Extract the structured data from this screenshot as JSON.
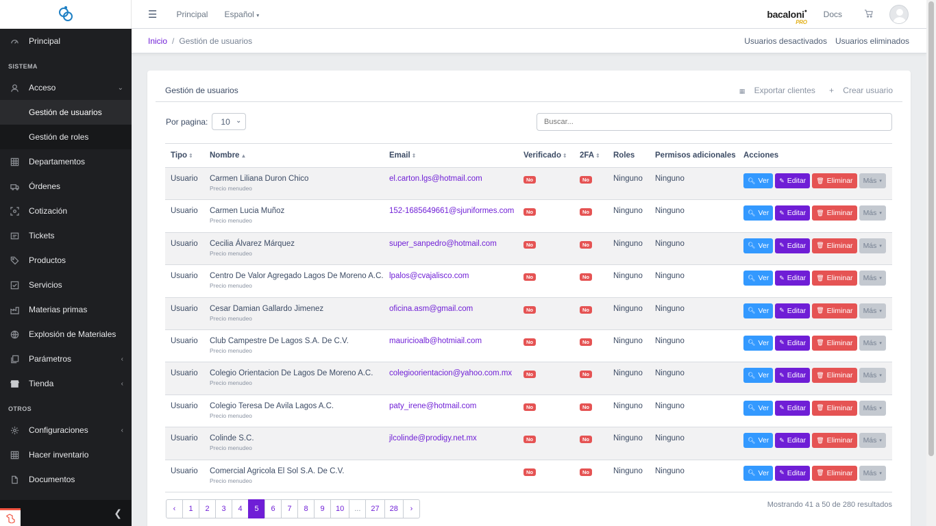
{
  "header": {
    "nav": [
      "Principal",
      "Español"
    ],
    "brand": "bacaloni",
    "brand_suffix": "PRO",
    "docs": "Docs"
  },
  "breadcrumb": {
    "home": "Inicio",
    "current": "Gestión de usuarios"
  },
  "subheader_links": [
    "Usuarios desactivados",
    "Usuarios eliminados"
  ],
  "sidebar": {
    "principal": "Principal",
    "section_sistema": "SISTEMA",
    "acceso": "Acceso",
    "acceso_sub": [
      "Gestión de usuarios",
      "Gestión de roles"
    ],
    "items": [
      "Departamentos",
      "Órdenes",
      "Cotización",
      "Tickets",
      "Productos",
      "Servicios",
      "Materias primas",
      "Explosión de Materiales",
      "Parámetros",
      "Tienda"
    ],
    "section_otros": "OTROS",
    "otros": [
      "Configuraciones",
      "Hacer inventario",
      "Documentos"
    ]
  },
  "card": {
    "title": "Gestión de usuarios",
    "export": "Exportar clientes",
    "create": "Crear usuario",
    "per_page_label": "Por pagina:",
    "per_page_value": "10",
    "search_placeholder": "Buscar..."
  },
  "table": {
    "headers": [
      "Tipo",
      "Nombre",
      "Email",
      "Verificado",
      "2FA",
      "Roles",
      "Permisos adicionales",
      "Acciones"
    ],
    "rows": [
      {
        "tipo": "Usuario",
        "nombre": "Carmen Liliana Duron Chico",
        "sub": "Precio menudeo",
        "email": "el.carton.lgs@hotmail.com",
        "verificado": "No",
        "tfa": "No",
        "roles": "Ninguno",
        "permisos": "Ninguno"
      },
      {
        "tipo": "Usuario",
        "nombre": "Carmen Lucia Muñoz",
        "sub": "Precio menudeo",
        "email": "152-1685649661@sjuniformes.com",
        "verificado": "No",
        "tfa": "No",
        "roles": "Ninguno",
        "permisos": "Ninguno"
      },
      {
        "tipo": "Usuario",
        "nombre": "Cecilia Álvarez Márquez",
        "sub": "Precio menudeo",
        "email": "super_sanpedro@hotmail.com",
        "verificado": "No",
        "tfa": "No",
        "roles": "Ninguno",
        "permisos": "Ninguno"
      },
      {
        "tipo": "Usuario",
        "nombre": "Centro De Valor Agregado Lagos De Moreno A.C.",
        "sub": "Precio menudeo",
        "email": "lpalos@cvajalisco.com",
        "verificado": "No",
        "tfa": "No",
        "roles": "Ninguno",
        "permisos": "Ninguno"
      },
      {
        "tipo": "Usuario",
        "nombre": "Cesar Damian Gallardo Jimenez",
        "sub": "Precio menudeo",
        "email": "oficina.asm@gmail.com",
        "verificado": "No",
        "tfa": "No",
        "roles": "Ninguno",
        "permisos": "Ninguno"
      },
      {
        "tipo": "Usuario",
        "nombre": "Club Campestre De Lagos S.A. De C.V.",
        "sub": "Precio menudeo",
        "email": "mauricioalb@hotmiail.com",
        "verificado": "No",
        "tfa": "No",
        "roles": "Ninguno",
        "permisos": "Ninguno"
      },
      {
        "tipo": "Usuario",
        "nombre": "Colegio Orientacion De Lagos De Moreno A.C.",
        "sub": "Precio menudeo",
        "email": "colegioorientacion@yahoo.com.mx",
        "verificado": "No",
        "tfa": "No",
        "roles": "Ninguno",
        "permisos": "Ninguno"
      },
      {
        "tipo": "Usuario",
        "nombre": "Colegio Teresa De Avila Lagos A.C.",
        "sub": "Precio menudeo",
        "email": "paty_irene@hotmail.com",
        "verificado": "No",
        "tfa": "No",
        "roles": "Ninguno",
        "permisos": "Ninguno"
      },
      {
        "tipo": "Usuario",
        "nombre": "Colinde S.C.",
        "sub": "Precio menudeo",
        "email": "jlcolinde@prodigy.net.mx",
        "verificado": "No",
        "tfa": "No",
        "roles": "Ninguno",
        "permisos": "Ninguno"
      },
      {
        "tipo": "Usuario",
        "nombre": "Comercial Agricola El Sol S.A. De C.V.",
        "sub": "Precio menudeo",
        "email": "",
        "verificado": "No",
        "tfa": "No",
        "roles": "Ninguno",
        "permisos": "Ninguno"
      }
    ],
    "actions": {
      "ver": "Ver",
      "editar": "Editar",
      "eliminar": "Eliminar",
      "mas": "Más"
    }
  },
  "pagination": {
    "prev": "‹",
    "pages": [
      "1",
      "2",
      "3",
      "4",
      "5",
      "6",
      "7",
      "8",
      "9",
      "10",
      "...",
      "27",
      "28"
    ],
    "current": "5",
    "next": "›",
    "summary": "Mostrando 41 a 50 de 280 resultados"
  },
  "colors": {
    "accent": "#6f1ed6",
    "info": "#3399ff",
    "danger": "#e55353",
    "sidebar": "#1e1f22"
  }
}
